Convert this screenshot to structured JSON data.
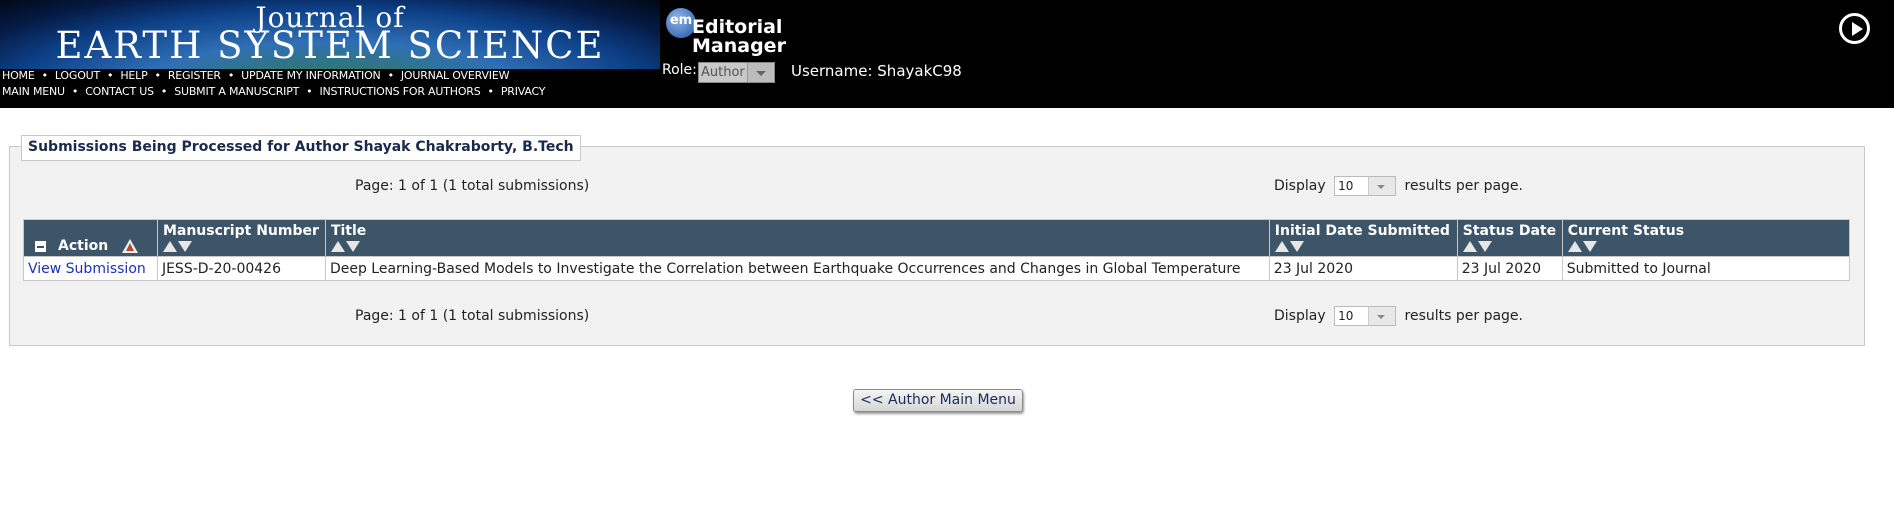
{
  "header": {
    "banner_line1": "Journal of",
    "banner_line2": "EARTH SYSTEM SCIENCE",
    "nav_row1": [
      "HOME",
      "LOGOUT",
      "HELP",
      "REGISTER",
      "UPDATE MY INFORMATION",
      "JOURNAL OVERVIEW"
    ],
    "nav_row2": [
      "MAIN MENU",
      "CONTACT US",
      "SUBMIT A MANUSCRIPT",
      "INSTRUCTIONS FOR AUTHORS",
      "PRIVACY"
    ],
    "em_logo_badge": "em",
    "em_logo_line1": "Editorial",
    "em_logo_line2": "Manager",
    "role_label": "Role:",
    "role_value": "Author",
    "username": "Username: ShayakC98",
    "play_icon": "play-circle-icon"
  },
  "panel": {
    "legend": "Submissions Being Processed for Author Shayak Chakraborty, B.Tech",
    "pager_text": "Page: 1 of 1 (1 total submissions)",
    "display_label": "Display",
    "display_value": "10",
    "display_suffix": "results per page."
  },
  "table": {
    "columns": [
      "Action",
      "Manuscript Number",
      "Title",
      "Initial Date Submitted",
      "Status Date",
      "Current Status"
    ],
    "rows": [
      {
        "action": "View Submission",
        "manuscript_number": "JESS-D-20-00426",
        "title": "Deep Learning-Based Models to Investigate the Correlation between Earthquake Occurrences and Changes in Global Temperature",
        "initial_date": "23 Jul 2020",
        "status_date": "23 Jul 2020",
        "current_status": "Submitted to Journal"
      }
    ]
  },
  "footer": {
    "back_button": "<< Author Main Menu"
  },
  "colors": {
    "header_bg": "#000000",
    "table_header_bg": "#3d5568",
    "link": "#1a31b8",
    "panel_bg": "#f2f2f2"
  }
}
